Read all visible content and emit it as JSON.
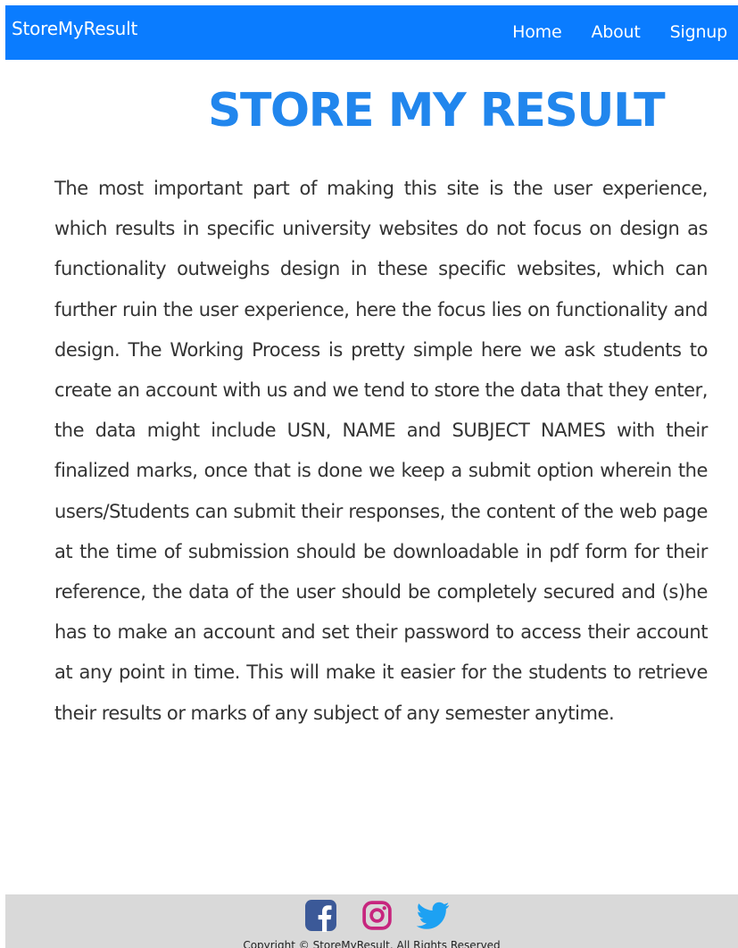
{
  "navbar": {
    "brand": "StoreMyResult",
    "links": [
      {
        "label": "Home"
      },
      {
        "label": "About"
      },
      {
        "label": "Signup"
      }
    ],
    "background_color": "#0a7cff"
  },
  "main": {
    "title": "STORE MY RESULT",
    "title_color": "#2186ed",
    "description": "The most important part of making this site is the user experience, which results in specific university websites do not focus on design as functionality outweighs design in these specific websites, which can further ruin the user experience, here the focus lies on functionality and design. The Working Process is pretty simple here we ask students to create an account with us and we tend to store the data that they enter, the data might include USN, NAME and SUBJECT NAMES with their finalized marks, once that is done we keep a submit option wherein the users/Students can submit their responses, the content of the web page at the time of submission should be downloadable in pdf form for their reference, the data of the user should be completely secured and (s)he has to make an account and set their password to access their account at any point in time. This will make it easier for the students to retrieve their results or marks of any subject of any semester anytime."
  },
  "footer": {
    "social_icons": [
      {
        "name": "facebook-icon",
        "color": "#3b5998"
      },
      {
        "name": "instagram-icon",
        "color": "#c7267e"
      },
      {
        "name": "twitter-icon",
        "color": "#1da1f2"
      }
    ],
    "copyright": "Copyright © StoreMyResult. All Rights Reserved",
    "background_color": "#d9d9d9"
  }
}
